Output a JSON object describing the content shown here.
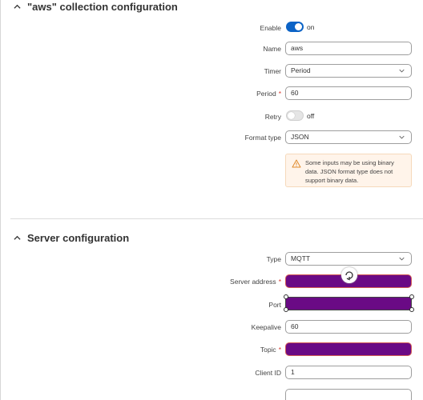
{
  "section1": {
    "title": "\"aws\" collection configuration",
    "enable": {
      "label": "Enable",
      "state": "on"
    },
    "name": {
      "label": "Name",
      "value": "aws"
    },
    "timer": {
      "label": "Timer",
      "value": "Period"
    },
    "period": {
      "label": "Period",
      "required": "*",
      "value": "60"
    },
    "retry": {
      "label": "Retry",
      "state": "off"
    },
    "format_type": {
      "label": "Format type",
      "value": "JSON"
    },
    "warning": {
      "text": "Some inputs may be using binary data. JSON format type does not support binary data."
    }
  },
  "section2": {
    "title": "Server configuration",
    "type": {
      "label": "Type",
      "value": "MQTT"
    },
    "server_address": {
      "label": "Server address",
      "required": "*"
    },
    "port": {
      "label": "Port"
    },
    "keepalive": {
      "label": "Keepalive",
      "value": "60"
    },
    "topic": {
      "label": "Topic",
      "required": "*"
    },
    "client_id": {
      "label": "Client ID",
      "value": "1"
    }
  },
  "colors": {
    "accent": "#0c63c6",
    "redaction": "#6a0a85",
    "warning_bg": "#fff4ea",
    "required": "#d9392e"
  }
}
